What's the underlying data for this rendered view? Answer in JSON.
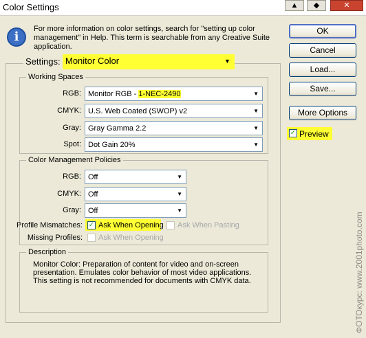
{
  "window": {
    "title": "Color Settings"
  },
  "info_text": "For more information on color settings, search for \"setting up color management\" in Help. This term is searchable from any Creative Suite application.",
  "settings": {
    "label": "Settings:",
    "value": "Monitor Color"
  },
  "working_spaces": {
    "title": "Working Spaces",
    "rgb": {
      "label": "RGB:",
      "value_prefix": "Monitor RGB - ",
      "value_highlight": "1-NEC-2490"
    },
    "cmyk": {
      "label": "CMYK:",
      "value": "U.S. Web Coated (SWOP) v2"
    },
    "gray": {
      "label": "Gray:",
      "value": "Gray Gamma 2.2"
    },
    "spot": {
      "label": "Spot:",
      "value": "Dot Gain 20%"
    }
  },
  "policies": {
    "title": "Color Management Policies",
    "rgb": {
      "label": "RGB:",
      "value": "Off"
    },
    "cmyk": {
      "label": "CMYK:",
      "value": "Off"
    },
    "gray": {
      "label": "Gray:",
      "value": "Off"
    },
    "profile_mismatches": {
      "label": "Profile Mismatches:",
      "ask_opening": "Ask When Opening",
      "ask_pasting": "Ask When Pasting"
    },
    "missing_profiles": {
      "label": "Missing Profiles:",
      "ask_opening": "Ask When Opening"
    }
  },
  "description": {
    "title": "Description",
    "text": "Monitor Color:  Preparation of content for video and on-screen presentation. Emulates color behavior of most video applications. This setting is not recommended for documents with CMYK data."
  },
  "buttons": {
    "ok": "OK",
    "cancel": "Cancel",
    "load": "Load...",
    "save": "Save...",
    "more_options": "More Options"
  },
  "preview": {
    "label": "Preview",
    "checked": true
  },
  "watermark": "ФОТОкурс: www.2001photo.com",
  "colors": {
    "highlight": "#ffff33",
    "dialog_bg": "#ece9d8",
    "check": "#21a121"
  }
}
